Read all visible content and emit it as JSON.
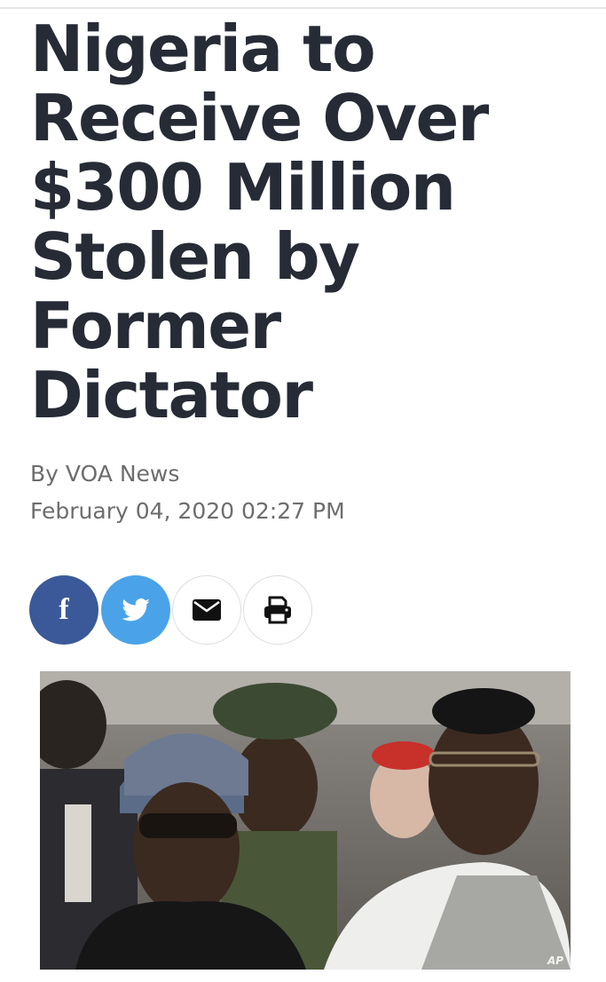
{
  "article": {
    "headline": "Nigeria to Receive Over $300 Million Stolen by Former Dictator",
    "byline": "By VOA News",
    "date": "February 04, 2020 02:27 PM"
  },
  "share": {
    "facebook_glyph": "f",
    "buttons": [
      "facebook-icon",
      "twitter-icon",
      "envelope-icon",
      "printer-icon"
    ],
    "colors": {
      "facebook": "#3b5998",
      "twitter": "#4aa3e9"
    }
  },
  "photo": {
    "credit": "AP"
  },
  "colors": {
    "headline": "#262b36",
    "meta": "#6d6d6d"
  }
}
